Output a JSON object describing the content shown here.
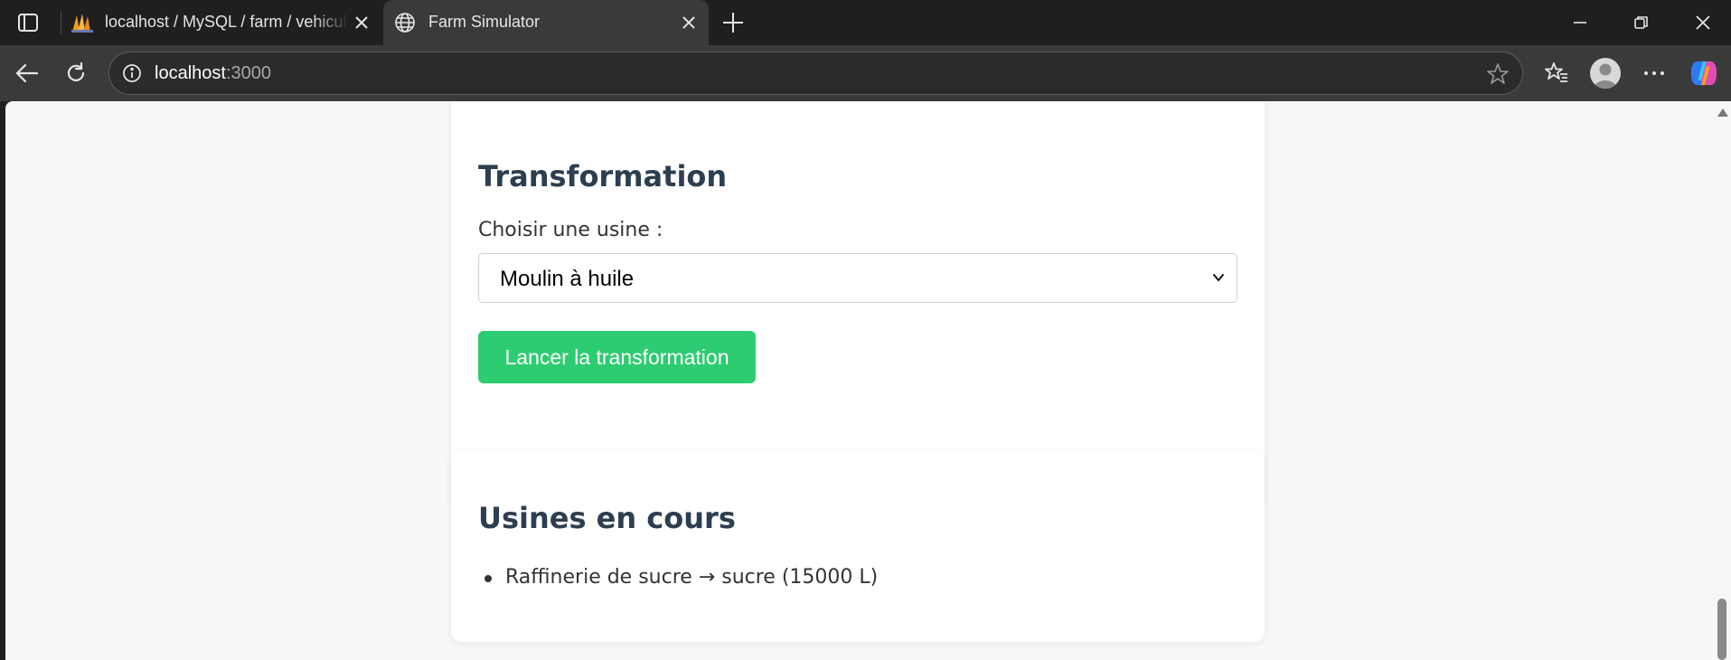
{
  "browser": {
    "tabs": [
      {
        "title": "localhost / MySQL / farm / vehicule",
        "icon": "phpmyadmin-icon",
        "active": false
      },
      {
        "title": "Farm Simulator",
        "icon": "globe-icon",
        "active": true
      }
    ],
    "address_bar": {
      "host": "localhost",
      "port": ":3000"
    }
  },
  "page": {
    "transformation": {
      "heading": "Transformation",
      "factory_label": "Choisir une usine :",
      "factory_selected": "Moulin à huile",
      "launch_button": "Lancer la transformation"
    },
    "running": {
      "heading": "Usines en cours",
      "items": [
        "Raffinerie de sucre → sucre (15000 L)"
      ]
    }
  },
  "colors": {
    "accent_green": "#2ecc71",
    "heading": "#2c3e50",
    "page_bg": "#f6f7f9"
  }
}
